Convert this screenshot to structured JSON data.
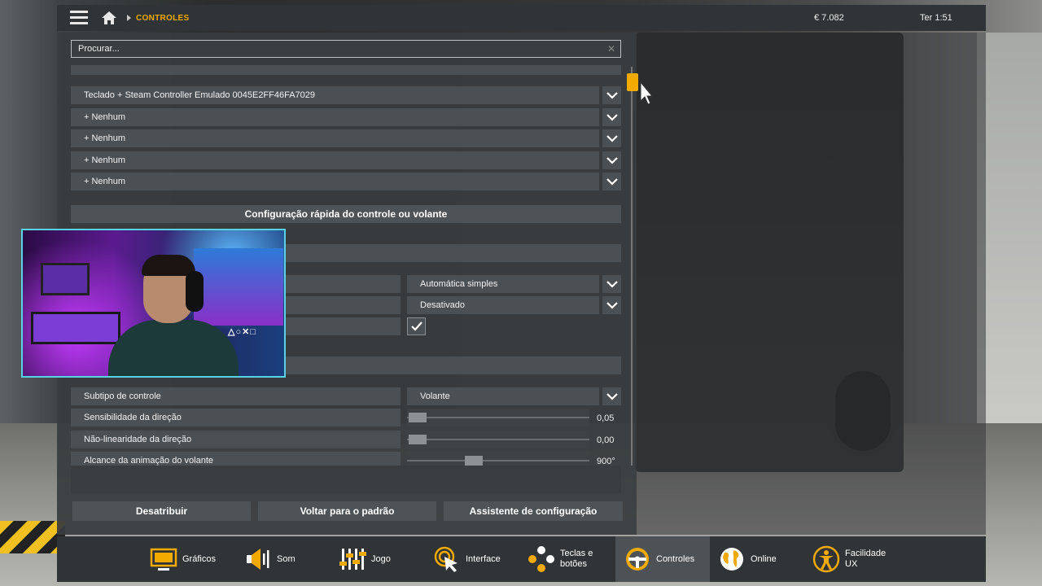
{
  "topbar": {
    "breadcrumb": "CONTROLES",
    "money": "€ 7.082",
    "clock": "Ter 1:51"
  },
  "search": {
    "placeholder": "Procurar..."
  },
  "device_rows": [
    {
      "label": "Teclado + Steam Controller Emulado 0045E2FF46FA7029"
    },
    {
      "label": "+ Nenhum"
    },
    {
      "label": "+ Nenhum"
    },
    {
      "label": "+ Nenhum"
    },
    {
      "label": "+ Nenhum"
    }
  ],
  "quick_setup_label": "Configuração rápida do controle ou volante",
  "settings": [
    {
      "value": "Automática simples"
    },
    {
      "value": "Desativado"
    }
  ],
  "controller": {
    "subtype_label": "Subtipo de controle",
    "subtype_value": "Volante",
    "sliders": [
      {
        "label": "Sensibilidade da direção",
        "display": "0,05",
        "fraction": 0.0
      },
      {
        "label": "Não-linearidade da direção",
        "display": "0,00",
        "fraction": 0.0
      },
      {
        "label": "Alcance da animação do volante",
        "display": "900°",
        "fraction": 0.35
      }
    ]
  },
  "footer_buttons": {
    "unassign": "Desatribuir",
    "reset": "Voltar para o padrão",
    "wizard": "Assistente de configuração"
  },
  "webcam": {
    "logo": "△○✕□"
  },
  "nav": [
    {
      "line1": "Gráficos",
      "line2": "",
      "icon": "monitor-icon"
    },
    {
      "line1": "Som",
      "line2": "",
      "icon": "speaker-icon"
    },
    {
      "line1": "Jogo",
      "line2": "",
      "icon": "sliders-icon"
    },
    {
      "line1": "Interface",
      "line2": "",
      "icon": "cursor-icon"
    },
    {
      "line1": "Teclas e",
      "line2": "botões",
      "icon": "gamepad-icon"
    },
    {
      "line1": "Controles",
      "line2": "",
      "icon": "steering-wheel-icon"
    },
    {
      "line1": "Online",
      "line2": "",
      "icon": "globe-icon"
    },
    {
      "line1": "Facilidade",
      "line2": "UX",
      "icon": "accessibility-icon"
    }
  ],
  "colors": {
    "accent": "#f2a900",
    "webcam_border": "#58d3e6"
  }
}
